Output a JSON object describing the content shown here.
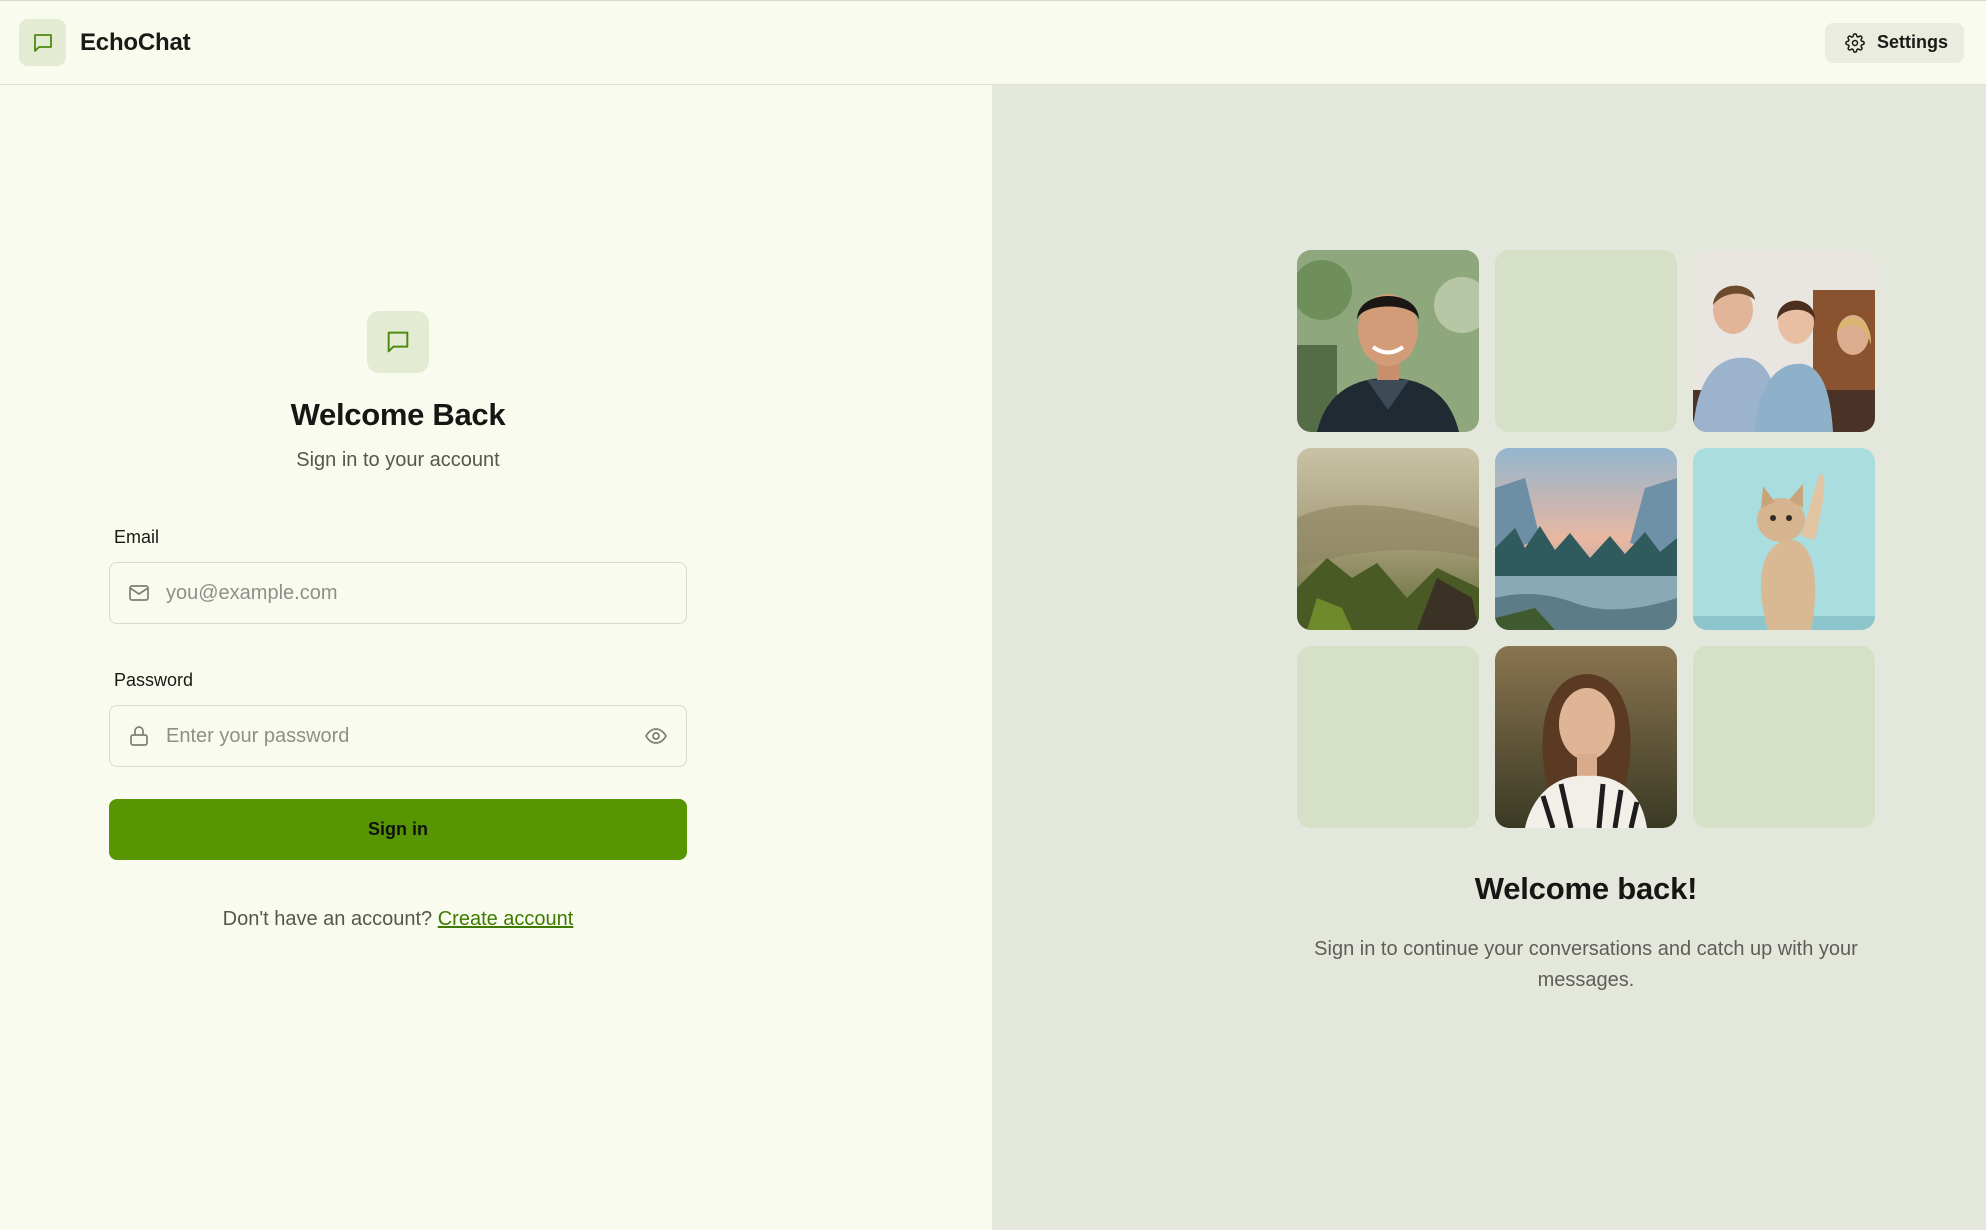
{
  "app": {
    "name": "EchoChat",
    "logo_icon": "message-square-icon"
  },
  "header": {
    "settings_label": "Settings",
    "settings_icon": "gear-icon"
  },
  "login": {
    "title": "Welcome Back",
    "subtitle": "Sign in to your account",
    "email": {
      "label": "Email",
      "placeholder": "you@example.com",
      "value": "",
      "icon": "mail-icon"
    },
    "password": {
      "label": "Password",
      "placeholder": "Enter your password",
      "value": "",
      "icon": "lock-icon",
      "toggle_icon": "eye-icon"
    },
    "submit_label": "Sign in",
    "signup_prompt": "Don't have an account?",
    "signup_link": "Create account"
  },
  "gallery": {
    "tiles": [
      {
        "kind": "photo",
        "subject": "smiling man portrait"
      },
      {
        "kind": "placeholder"
      },
      {
        "kind": "photo",
        "subject": "group of friends at table"
      },
      {
        "kind": "photo",
        "subject": "mountain valley landscape"
      },
      {
        "kind": "photo",
        "subject": "mountain river with trees"
      },
      {
        "kind": "photo",
        "subject": "kitten raising paw"
      },
      {
        "kind": "placeholder"
      },
      {
        "kind": "photo",
        "subject": "woman portrait"
      },
      {
        "kind": "placeholder"
      }
    ]
  },
  "promo": {
    "title": "Welcome back!",
    "text": "Sign in to continue your conversations and catch up with your messages."
  },
  "colors": {
    "accent": "#579503",
    "link": "#3f7a00",
    "left_bg": "#f9fbef",
    "right_bg": "#e4e7dc",
    "tile_placeholder": "#d6e0c6"
  }
}
